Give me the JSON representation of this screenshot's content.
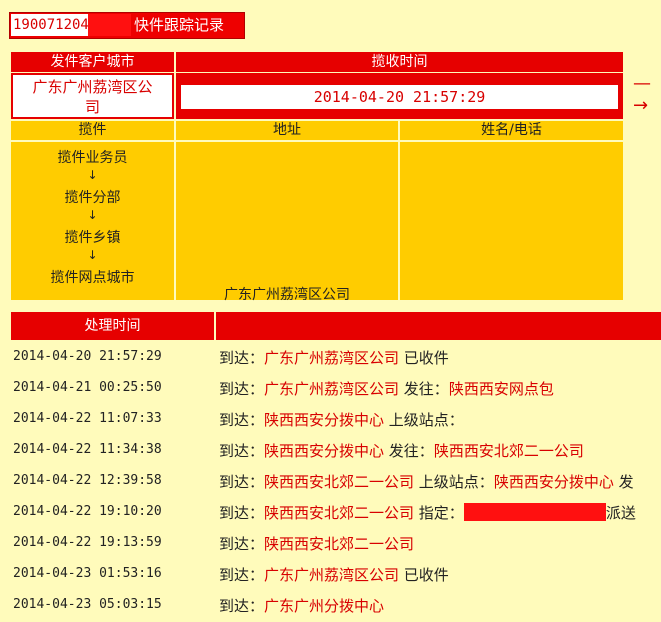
{
  "header": {
    "tracking_number": "190071204",
    "title": "快件跟踪记录"
  },
  "summary": {
    "origin_city_label": "发件客户城市",
    "pickup_time_label": "揽收时间",
    "origin_city_line1": "广东广州荔湾区公",
    "origin_city_line2": "司",
    "pickup_time": "2014-04-20 21:57:29",
    "arrow_glyph": "—→"
  },
  "pickup": {
    "col_pickup": "揽件",
    "col_address": "地址",
    "col_name_phone": "姓名/电话",
    "steps": [
      "揽件业务员",
      "揽件分部",
      "揽件乡镇",
      "揽件网点城市"
    ],
    "arrow": "↓",
    "address": "广东广州荔湾区公司"
  },
  "records": {
    "col_time": "处理时间",
    "rows": [
      {
        "time": "2014-04-20 21:57:29",
        "parts": [
          [
            "到达：",
            0
          ],
          [
            "广东广州荔湾区公司",
            1
          ],
          [
            " 已收件",
            0
          ]
        ]
      },
      {
        "time": "2014-04-21 00:25:50",
        "parts": [
          [
            "到达：",
            0
          ],
          [
            "广东广州荔湾区公司",
            1
          ],
          [
            " 发往：",
            0
          ],
          [
            "陕西西安网点包",
            1
          ]
        ]
      },
      {
        "time": "2014-04-22 11:07:33",
        "parts": [
          [
            "到达：",
            0
          ],
          [
            "陕西西安分拨中心",
            1
          ],
          [
            " 上级站点：",
            0
          ]
        ]
      },
      {
        "time": "2014-04-22 11:34:38",
        "parts": [
          [
            "到达：",
            0
          ],
          [
            "陕西西安分拨中心",
            1
          ],
          [
            " 发往：",
            0
          ],
          [
            "陕西西安北郊二一公司",
            1
          ]
        ]
      },
      {
        "time": "2014-04-22 12:39:58",
        "parts": [
          [
            "到达：",
            0
          ],
          [
            "陕西西安北郊二一公司",
            1
          ],
          [
            " 上级站点：",
            0
          ],
          [
            "陕西西安分拨中心",
            1
          ],
          [
            " 发",
            0
          ]
        ]
      },
      {
        "time": "2014-04-22 19:10:20",
        "parts": [
          [
            "到达：",
            0
          ],
          [
            "陕西西安北郊二一公司",
            1
          ],
          [
            " 指定：",
            0
          ],
          [
            "",
            2
          ],
          [
            "派送",
            0
          ]
        ]
      },
      {
        "time": "2014-04-22 19:13:59",
        "parts": [
          [
            "到达：",
            0
          ],
          [
            "陕西西安北郊二一公司",
            1
          ]
        ]
      },
      {
        "time": "2014-04-23 01:53:16",
        "parts": [
          [
            "到达：",
            0
          ],
          [
            "广东广州荔湾区公司",
            1
          ],
          [
            " 已收件",
            0
          ]
        ]
      },
      {
        "time": "2014-04-23 05:03:15",
        "parts": [
          [
            "到达：",
            0
          ],
          [
            "广东广州分拨中心",
            1
          ]
        ]
      }
    ]
  }
}
